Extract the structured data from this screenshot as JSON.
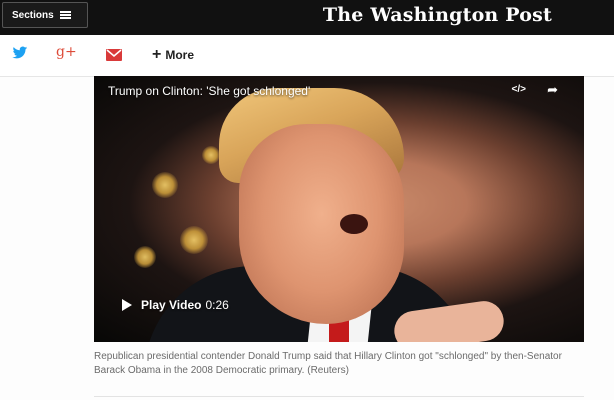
{
  "header": {
    "sections_label": "Sections",
    "logo_text": "The Washington Post"
  },
  "share": {
    "twitter_icon": "twitter-bird-icon",
    "gplus_icon": "google-plus-icon",
    "gplus_label": "g+",
    "mail_icon": "mail-envelope-icon",
    "more_label": "More"
  },
  "video": {
    "title": "Trump on Clinton: 'She got schlonged'",
    "embed_label": "</>",
    "play_label": "Play Video",
    "duration": "0:26"
  },
  "caption": "Republican presidential contender Donald Trump said that Hillary Clinton got \"schlonged\" by then-Senator Barack Obama in the 2008 Democratic primary. (Reuters)",
  "colors": {
    "header_bg": "#111111",
    "google_red": "#dd4b39",
    "twitter_blue": "#1da1f2",
    "mail_red": "#d93a3a"
  }
}
